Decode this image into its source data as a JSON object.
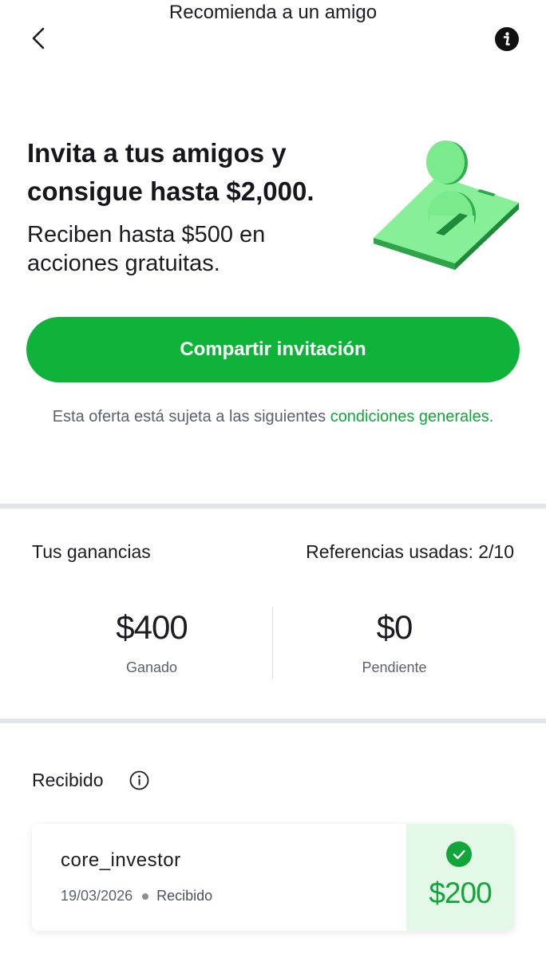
{
  "header": {
    "title": "Recomienda a un amigo",
    "back_icon": "chevron-left-icon",
    "info_icon": "info-icon"
  },
  "hero": {
    "title": "Invita a tus amigos y consigue hasta $2,000.",
    "subtitle": "Reciben hasta $500 en acciones gratuitas.",
    "illustration": "phone-with-coins-illustration"
  },
  "cta": {
    "label": "Compartir invitación"
  },
  "terms": {
    "text": "Esta oferta está sujeta a las siguientes ",
    "link_text": "condiciones generales",
    "suffix": "."
  },
  "earnings": {
    "label": "Tus ganancias",
    "refs_label": "Referencias usadas: 2/10",
    "earned_value": "$400",
    "earned_caption": "Ganado",
    "pending_value": "$0",
    "pending_caption": "Pendiente"
  },
  "received": {
    "label": "Recibido",
    "info_icon": "info-circle-icon",
    "items": [
      {
        "name": "core_investor",
        "date": "19/03/2026",
        "status": "Recibido",
        "amount": "$200",
        "status_icon": "check-circle-icon"
      }
    ]
  },
  "colors": {
    "accent": "#0fb33a",
    "link": "#12a53a",
    "amount_bg": "#e4f8e8"
  }
}
